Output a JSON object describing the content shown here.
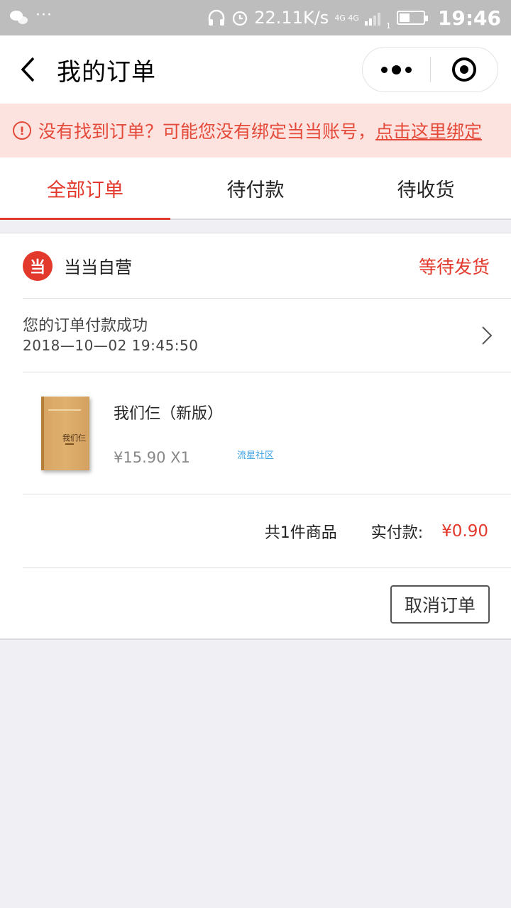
{
  "status_bar": {
    "speed": "22.11K/s",
    "network": "4G 4G",
    "sim": "1",
    "time": "19:46",
    "dots": "···"
  },
  "nav": {
    "title": "我的订单"
  },
  "banner": {
    "message": "没有找到订单？可能您没有绑定当当账号，",
    "link": "点击这里绑定",
    "color": "#e34a3a"
  },
  "tabs": [
    {
      "label": "全部订单",
      "active": true
    },
    {
      "label": "待付款",
      "active": false
    },
    {
      "label": "待收货",
      "active": false
    }
  ],
  "order": {
    "shop_logo": "当",
    "shop_name": "当当自营",
    "status": "等待发货",
    "payment_message": "您的订单付款成功",
    "payment_time": "2018—10—02 19:45:50",
    "product": {
      "name": "我们仨（新版）",
      "price_qty": "¥15.90 X1",
      "book_cover_title": "我们仨"
    },
    "watermark": "流星社区",
    "item_count": "共1件商品",
    "paid_label": "实付款:",
    "paid_amount": "¥0.90",
    "cancel_label": "取消订单"
  },
  "colors": {
    "accent": "#e3392c",
    "banner_bg": "#fde3df",
    "page_bg": "#efeff4"
  }
}
